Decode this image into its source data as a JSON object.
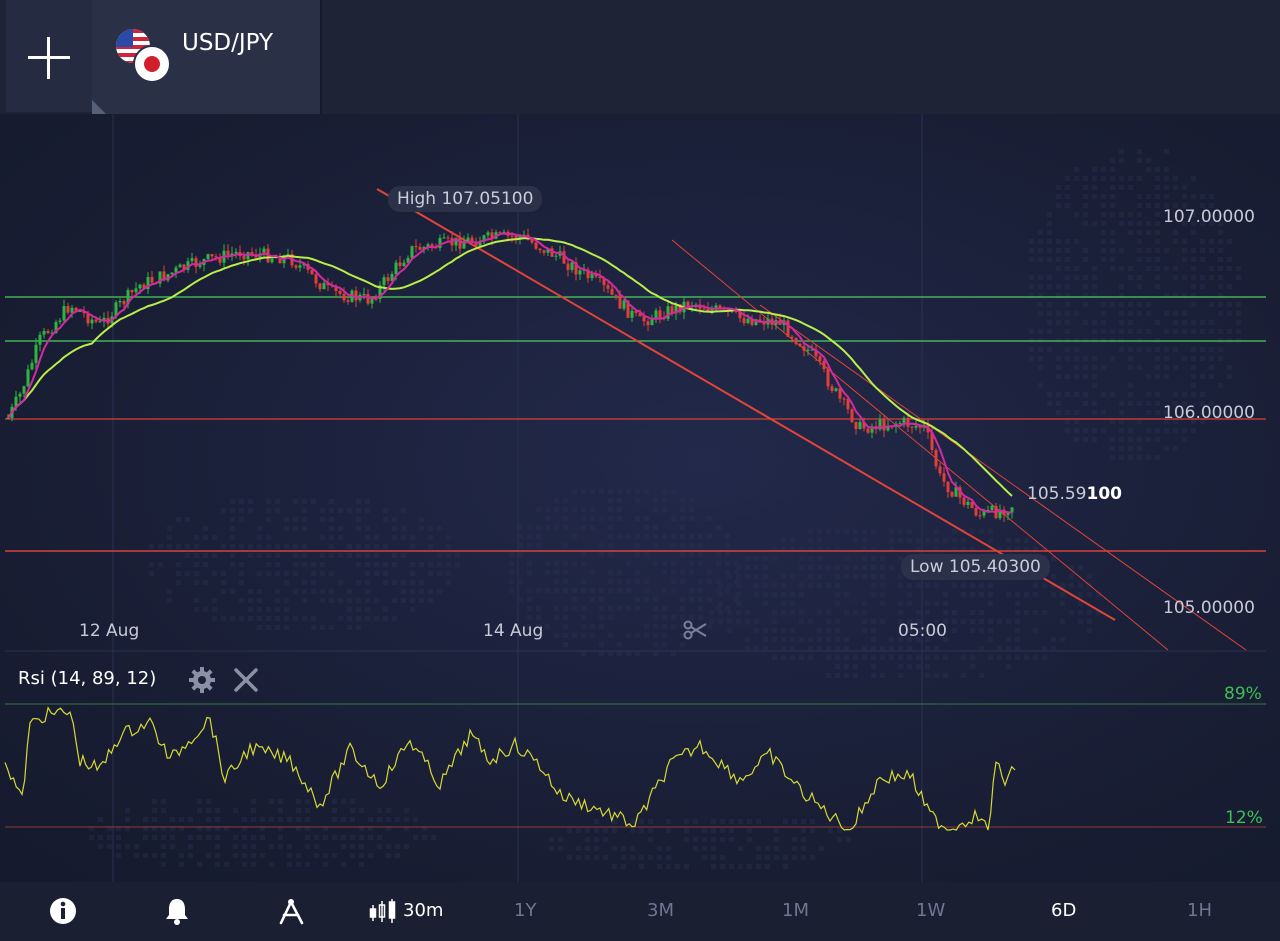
{
  "header": {
    "asset": {
      "name": "USD/JPY",
      "flags": [
        "us-flag-icon",
        "jp-flag-icon"
      ]
    }
  },
  "chart": {
    "price_axis": [
      "107.00000",
      "106.00000",
      "105.00000"
    ],
    "date_axis": [
      "12 Aug",
      "14 Aug",
      "05:00"
    ],
    "high": {
      "label": "High",
      "value": "107.05100"
    },
    "low": {
      "label": "Low",
      "value": "105.40300"
    },
    "current": {
      "main": "105.59",
      "bold": "100"
    },
    "colors": {
      "bull": "#2fb344",
      "bear": "#e0403a",
      "ma_fast": "#d32aa0",
      "ma_slow": "#b9ee4a",
      "trend": "#e0443a",
      "support": "#4ad05a"
    }
  },
  "rsi": {
    "label": "Rsi (14, 89, 12)",
    "upper": "89%",
    "lower": "12%",
    "line_color": "#d6da33"
  },
  "toolbar": {
    "icons": [
      "info-icon",
      "bell-icon",
      "drawing-tool-icon"
    ],
    "chart_type_label": "30m",
    "timeframes": [
      "1Y",
      "3M",
      "1M",
      "1W",
      "6D",
      "1H"
    ],
    "active_timeframe": "6D"
  }
}
